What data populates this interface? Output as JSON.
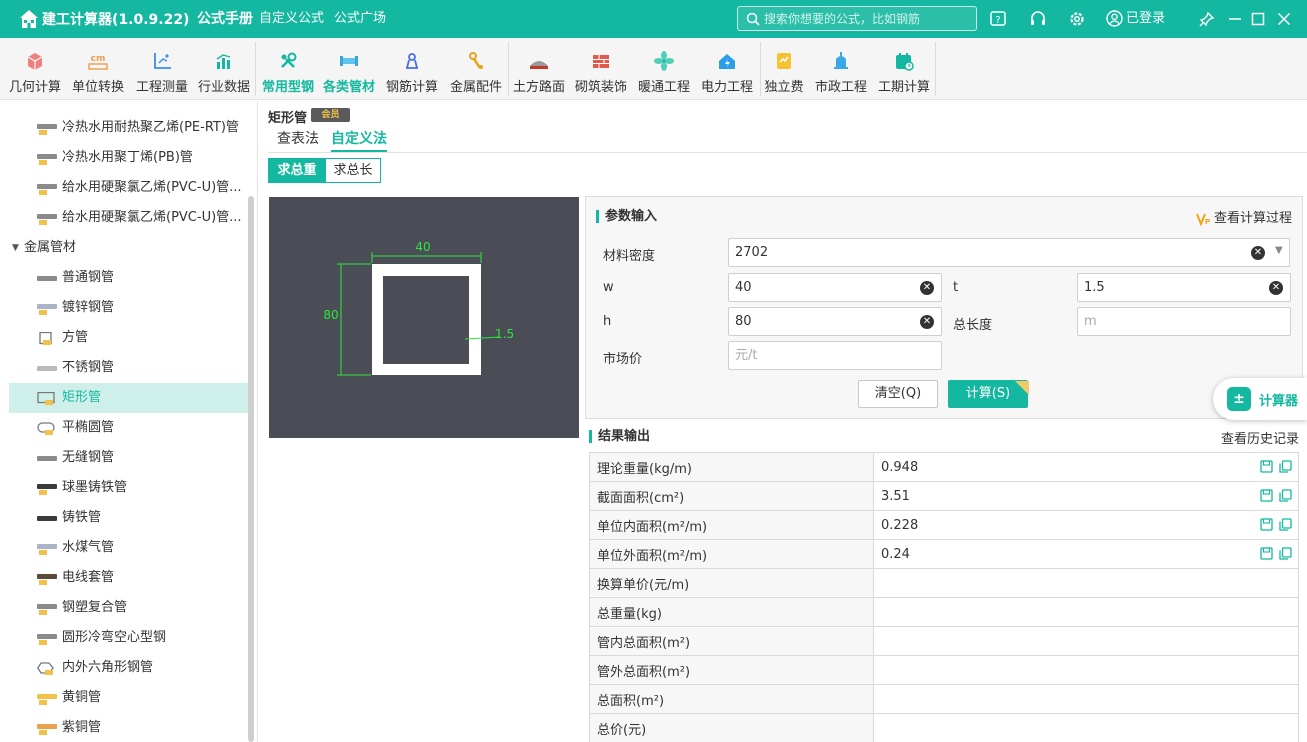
{
  "app": {
    "title": "建工计算器(1.0.9.22)"
  },
  "top_nav": [
    {
      "label": "公式手册",
      "active": true
    },
    {
      "label": "自定义公式",
      "active": false
    },
    {
      "label": "公式广场",
      "active": false
    }
  ],
  "search": {
    "placeholder": "搜索你想要的公式，比如钢筋"
  },
  "account": {
    "login_label": "已登录"
  },
  "title_icons": [
    "help-icon",
    "headset-icon",
    "gear-icon",
    "user-icon",
    "pin-icon",
    "minimize-icon",
    "maximize-icon",
    "close-icon"
  ],
  "ribbon": [
    {
      "label": "几何计算",
      "icon": "cube-icon"
    },
    {
      "label": "单位转换",
      "icon": "ruler-cm-icon"
    },
    {
      "label": "工程测量",
      "icon": "axes-icon"
    },
    {
      "label": "行业数据",
      "icon": "bar-chart-icon"
    },
    {
      "label": "常用型钢",
      "icon": "wrench-icon",
      "active": true
    },
    {
      "label": "各类管材",
      "icon": "pipe-icon",
      "active": true
    },
    {
      "label": "钢筋计算",
      "icon": "rebar-icon"
    },
    {
      "label": "金属配件",
      "icon": "fitting-icon"
    },
    {
      "label": "土方路面",
      "icon": "road-icon"
    },
    {
      "label": "砌筑装饰",
      "icon": "brick-icon"
    },
    {
      "label": "暖通工程",
      "icon": "fan-icon"
    },
    {
      "label": "电力工程",
      "icon": "power-icon"
    },
    {
      "label": "独立费",
      "icon": "fee-icon"
    },
    {
      "label": "市政工程",
      "icon": "hydrant-icon"
    },
    {
      "label": "工期计算",
      "icon": "calendar-icon"
    }
  ],
  "sidebar": {
    "items_before": [
      {
        "label": "冷热水用耐热聚乙烯(PE-RT)管"
      },
      {
        "label": "冷热水用聚丁烯(PB)管"
      },
      {
        "label": "给水用硬聚氯乙烯(PVC-U)管..."
      },
      {
        "label": "给水用硬聚氯乙烯(PVC-U)管..."
      }
    ],
    "group": {
      "label": "金属管材",
      "expanded": true
    },
    "items": [
      {
        "label": "普通钢管"
      },
      {
        "label": "镀锌钢管"
      },
      {
        "label": "方管"
      },
      {
        "label": "不锈钢管"
      },
      {
        "label": "矩形管",
        "selected": true
      },
      {
        "label": "平椭圆管"
      },
      {
        "label": "无缝钢管"
      },
      {
        "label": "球墨铸铁管"
      },
      {
        "label": "铸铁管"
      },
      {
        "label": "水煤气管"
      },
      {
        "label": "电线套管"
      },
      {
        "label": "钢塑复合管"
      },
      {
        "label": "圆形冷弯空心型钢"
      },
      {
        "label": "内外六角形钢管"
      },
      {
        "label": "黄铜管"
      },
      {
        "label": "紫铜管"
      }
    ]
  },
  "page": {
    "title": "矩形管",
    "badge": "会员",
    "tabs": [
      {
        "label": "查表法",
        "active": false
      },
      {
        "label": "自定义法",
        "active": true
      }
    ],
    "modes": [
      {
        "label": "求总重",
        "active": true
      },
      {
        "label": "求总长",
        "active": false
      }
    ]
  },
  "diagram": {
    "width_label": "40",
    "height_label": "80",
    "thickness_label": "1.5"
  },
  "params": {
    "title": "参数输入",
    "view_process": "查看计算过程",
    "density": {
      "label": "材料密度",
      "value": "2702"
    },
    "w": {
      "label": "w",
      "value": "40"
    },
    "t": {
      "label": "t",
      "value": "1.5"
    },
    "h": {
      "label": "h",
      "value": "80"
    },
    "total_length": {
      "label": "总长度",
      "placeholder": "m"
    },
    "market_price": {
      "label": "市场价",
      "placeholder": "元/t"
    },
    "clear_button": "清空(Q)",
    "calc_button": "计算(S)"
  },
  "floating": {
    "label": "计算器"
  },
  "results": {
    "title": "结果输出",
    "history": "查看历史记录",
    "rows": [
      {
        "name": "理论重量(kg/m)",
        "value": "0.948",
        "actions": true
      },
      {
        "name": "截面面积(cm²)",
        "value": "3.51",
        "actions": true
      },
      {
        "name": "单位内面积(m²/m)",
        "value": "0.228",
        "actions": true
      },
      {
        "name": "单位外面积(m²/m)",
        "value": "0.24",
        "actions": true
      },
      {
        "name": "换算单价(元/m)",
        "value": ""
      },
      {
        "name": "总重量(kg)",
        "value": ""
      },
      {
        "name": "管内总面积(m²)",
        "value": ""
      },
      {
        "name": "管外总面积(m²)",
        "value": ""
      },
      {
        "name": "总面积(m²)",
        "value": ""
      },
      {
        "name": "总价(元)",
        "value": ""
      }
    ]
  },
  "colors": {
    "accent": "#14b8a0",
    "selected_bg": "#cff0ea",
    "diagram_bg": "#4a4d55",
    "diagram_line": "#2ee63c"
  }
}
